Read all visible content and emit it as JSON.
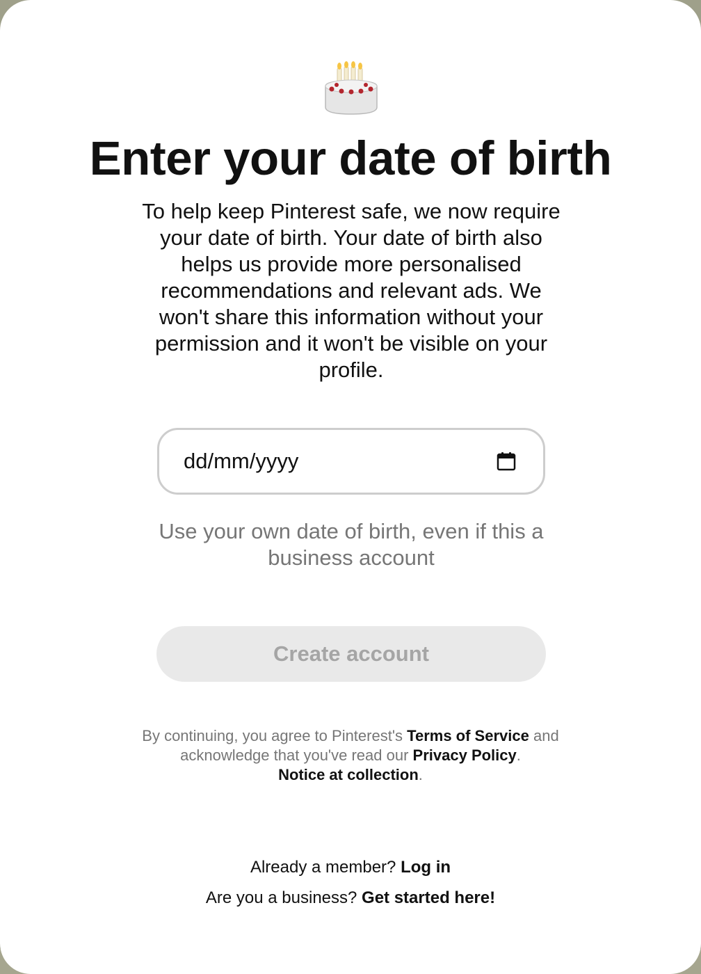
{
  "modal": {
    "icon": "birthday-cake-icon",
    "title": "Enter your date of birth",
    "description": "To help keep Pinterest safe, we now require your date of birth. Your date of birth also helps us provide more personalised recommendations and relevant ads. We won't share this information without your permission and it won't be visible on your profile."
  },
  "date_input": {
    "placeholder": "dd/mm/yyyy",
    "value": "",
    "icon": "calendar-icon"
  },
  "hint": "Use your own date of birth, even if this a business account",
  "create_button": {
    "label": "Create account",
    "state": "disabled"
  },
  "legal": {
    "prefix": "By continuing, you agree to Pinterest's",
    "terms_link": "Terms of Service",
    "and": "and",
    "middle": "acknowledge that you've read our",
    "privacy_link": "Privacy Policy",
    "period": ".",
    "notice_link": "Notice at collection",
    "period2": "."
  },
  "footer": {
    "member_text": "Already a member?",
    "login_link": "Log in",
    "business_text": "Are you a business?",
    "business_link": "Get started here!"
  },
  "colors": {
    "text": "#111111",
    "muted": "#767676",
    "button_disabled_bg": "#e9e9e9",
    "button_disabled_text": "#a5a5a5",
    "input_border": "#cdcdcd"
  }
}
